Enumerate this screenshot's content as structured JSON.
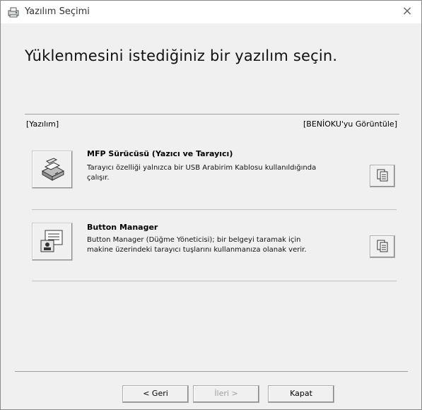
{
  "window": {
    "title": "Yazılım Seçimi",
    "close_symbol": "×"
  },
  "heading": "Yüklenmesini istediğiniz bir yazılım seçin.",
  "section": {
    "left_label": "[Yazılım]",
    "right_label": "[BENİOKU'yu Görüntüle]"
  },
  "items": [
    {
      "title": "MFP Sürücüsü (Yazıcı ve Tarayıcı)",
      "desc_line1": "Tarayıcı özelliği yalnızca bir USB Arabirim Kablosu kullanıldığında",
      "desc_line2": "çalışır.",
      "icon": "printer-scanner-icon",
      "doc_icon": "document-icon"
    },
    {
      "title": "Button Manager",
      "desc_line1": "Button Manager (Düğme Yöneticisi); bir belgeyi taramak için",
      "desc_line2": "makine üzerindeki tarayıcı tuşlarını kullanmanıza olanak verir.",
      "icon": "button-manager-icon",
      "doc_icon": "document-icon"
    }
  ],
  "footer": {
    "back_label": "< Geri",
    "next_label": "İleri >",
    "next_enabled": false,
    "close_label": "Kapat"
  }
}
